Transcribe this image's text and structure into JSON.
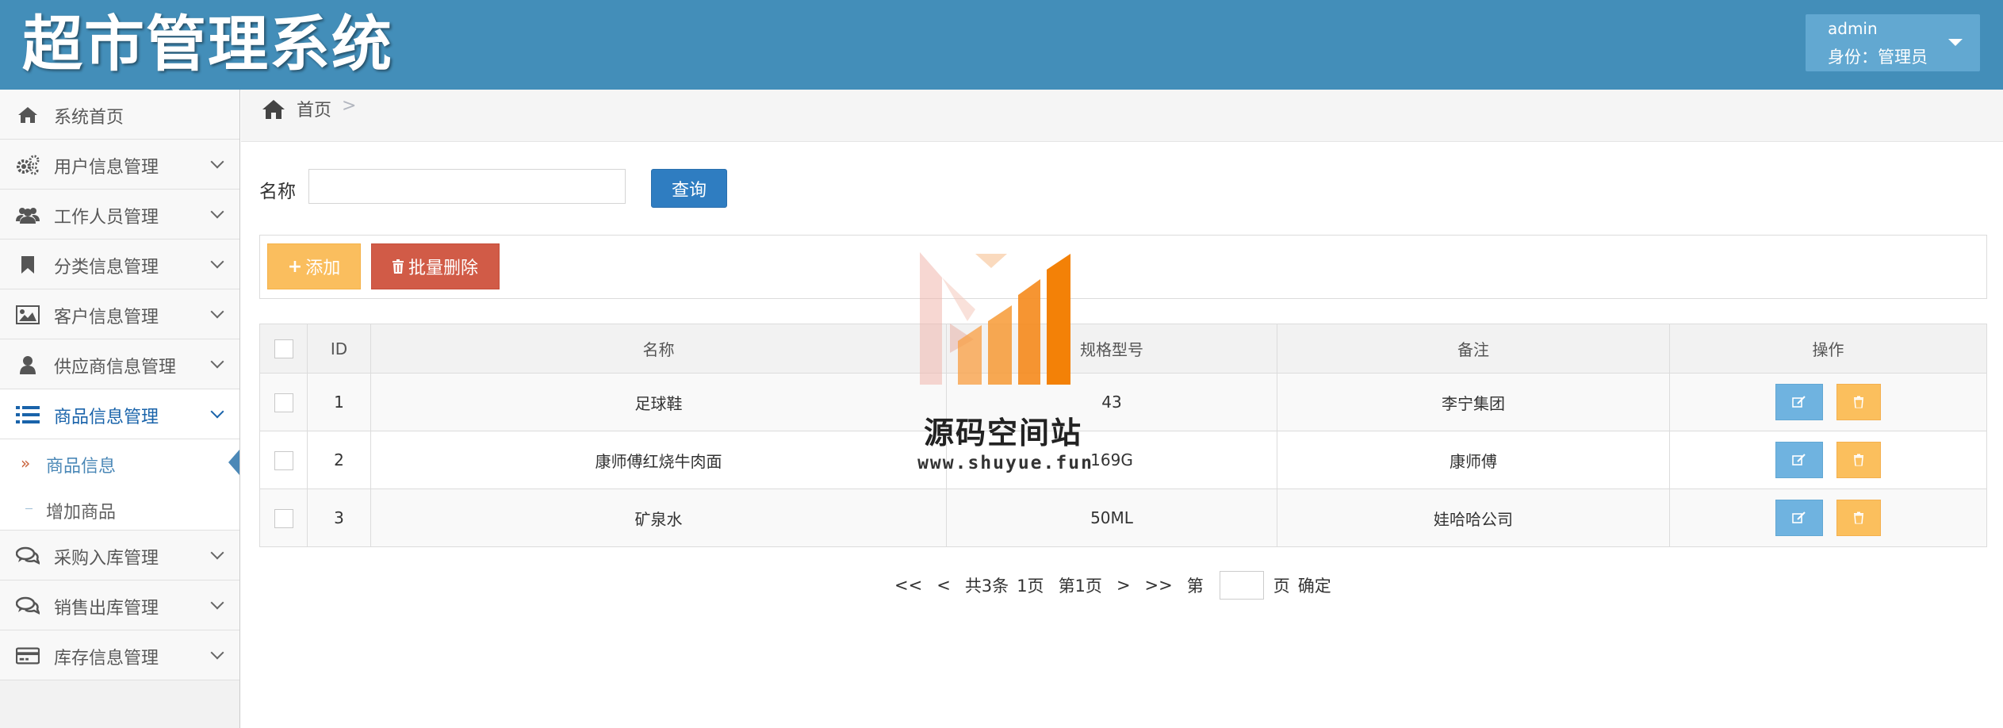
{
  "header": {
    "title": "超市管理系统",
    "user": "admin",
    "role": "身份：管理员"
  },
  "sidebar": {
    "items": [
      {
        "label": "系统首页",
        "icon": "home-icon"
      },
      {
        "label": "用户信息管理",
        "icon": "gears-icon"
      },
      {
        "label": "工作人员管理",
        "icon": "users-icon"
      },
      {
        "label": "分类信息管理",
        "icon": "bookmark-icon"
      },
      {
        "label": "客户信息管理",
        "icon": "picture-icon"
      },
      {
        "label": "供应商信息管理",
        "icon": "user-icon"
      },
      {
        "label": "商品信息管理",
        "icon": "list-icon"
      },
      {
        "label": "采购入库管理",
        "icon": "comments-icon"
      },
      {
        "label": "销售出库管理",
        "icon": "comments-icon"
      },
      {
        "label": "库存信息管理",
        "icon": "credit-card-icon"
      }
    ],
    "subitems": [
      {
        "label": "商品信息"
      },
      {
        "label": "增加商品"
      }
    ]
  },
  "breadcrumb": {
    "home": "首页",
    "separator": ">"
  },
  "search": {
    "label": "名称",
    "value": "",
    "button": "查询"
  },
  "toolbar": {
    "add": "添加",
    "batch_delete": "批量删除"
  },
  "table": {
    "headers": [
      "ID",
      "名称",
      "规格型号",
      "备注",
      "操作"
    ],
    "rows": [
      {
        "id": "1",
        "name": "足球鞋",
        "spec": "43",
        "note": "李宁集团"
      },
      {
        "id": "2",
        "name": "康师傅红烧牛肉面",
        "spec": "169G",
        "note": "康师傅"
      },
      {
        "id": "3",
        "name": "矿泉水",
        "spec": "50ML",
        "note": "娃哈哈公司"
      }
    ]
  },
  "pagination": {
    "first": "<<",
    "prev": "<",
    "total": "共3条",
    "pages": "1页",
    "current": "第1页",
    "next": ">",
    "last": ">>",
    "goto_prefix": "第",
    "goto_suffix": "页",
    "confirm": "确定"
  },
  "watermark": {
    "title": "源码空间站",
    "url": "www.shuyue.fun"
  },
  "colors": {
    "header": "#438eb9",
    "primary": "#2f7dc1",
    "warning": "#fabe5e",
    "danger": "#d15b47",
    "info": "#6fb3e0"
  }
}
